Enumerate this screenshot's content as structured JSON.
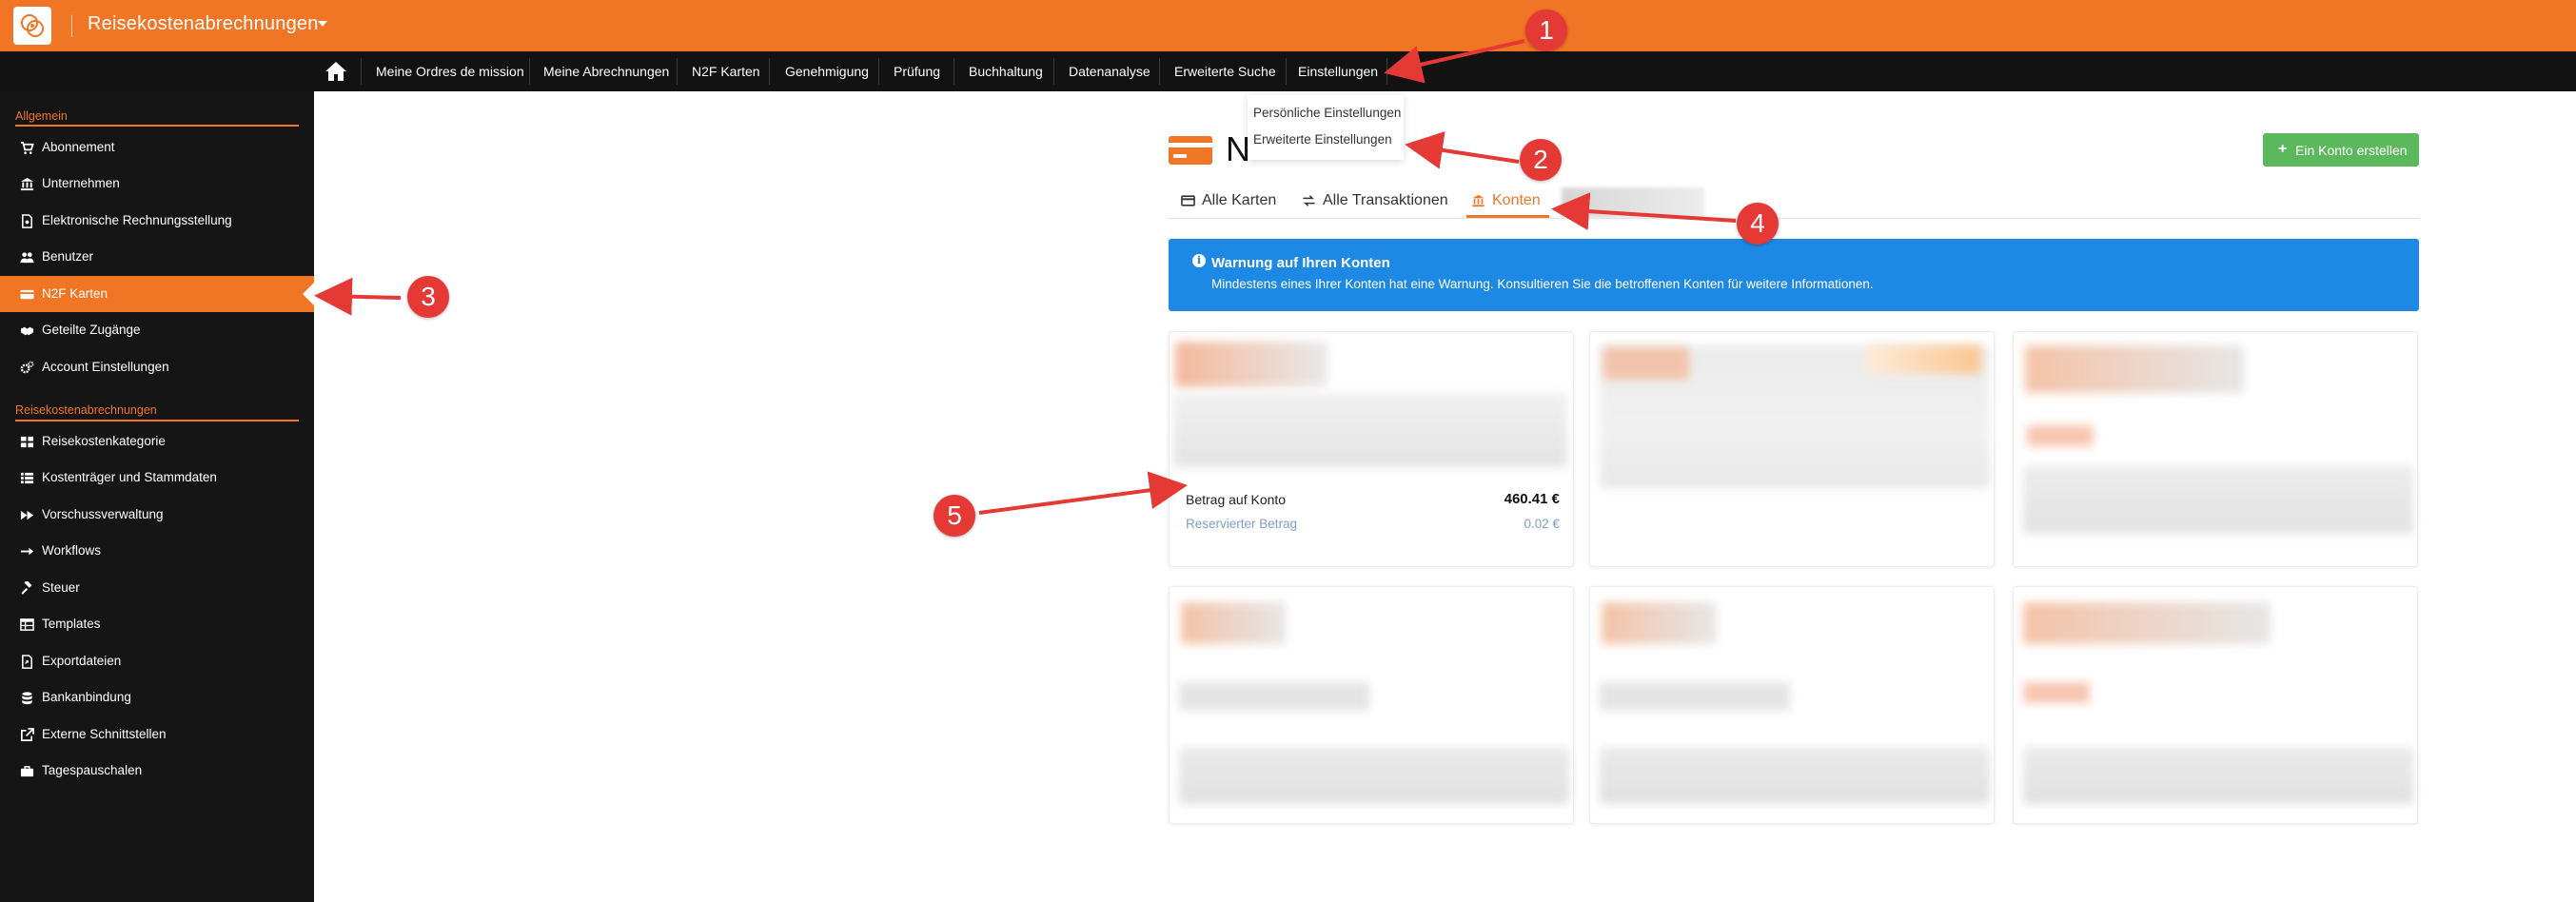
{
  "header": {
    "app_title": "Reisekostenabrechnungen",
    "brand_color": "#f07524"
  },
  "nav": {
    "items": [
      {
        "label": "Meine Ordres de mission"
      },
      {
        "label": "Meine Abrechnungen"
      },
      {
        "label": "N2F Karten"
      },
      {
        "label": "Genehmigung"
      },
      {
        "label": "Prüfung"
      },
      {
        "label": "Buchhaltung"
      },
      {
        "label": "Datenanalyse"
      },
      {
        "label": "Erweiterte Suche"
      },
      {
        "label": "Einstellungen"
      }
    ]
  },
  "dropdown": {
    "items": [
      {
        "label": "Persönliche Einstellungen"
      },
      {
        "label": "Erweiterte Einstellungen"
      }
    ]
  },
  "sidebar": {
    "section_general": "Allgemein",
    "section_expenses": "Reisekostenabrechnungen",
    "general_items": [
      {
        "label": "Abonnement",
        "icon": "cart-icon"
      },
      {
        "label": "Unternehmen",
        "icon": "bank-icon"
      },
      {
        "label": "Elektronische Rechnungsstellung",
        "icon": "document-icon"
      },
      {
        "label": "Benutzer",
        "icon": "users-icon"
      },
      {
        "label": "N2F Karten",
        "icon": "credit-card-icon",
        "active": true
      },
      {
        "label": "Geteilte Zugänge",
        "icon": "handshake-icon"
      },
      {
        "label": "Account Einstellungen",
        "icon": "gears-icon"
      }
    ],
    "expense_items": [
      {
        "label": "Reisekostenkategorie",
        "icon": "grid-icon"
      },
      {
        "label": "Kostenträger und Stammdaten",
        "icon": "list-icon"
      },
      {
        "label": "Vorschussverwaltung",
        "icon": "fast-forward-icon"
      },
      {
        "label": "Workflows",
        "icon": "arrow-right-icon"
      },
      {
        "label": "Steuer",
        "icon": "gavel-icon"
      },
      {
        "label": "Templates",
        "icon": "table-icon"
      },
      {
        "label": "Exportdateien",
        "icon": "export-icon"
      },
      {
        "label": "Bankanbindung",
        "icon": "database-icon"
      },
      {
        "label": "Externe Schnittstellen",
        "icon": "external-link-icon"
      },
      {
        "label": "Tagespauschalen",
        "icon": "briefcase-icon"
      }
    ]
  },
  "main": {
    "title_initial": "N",
    "create_button": "Ein Konto erstellen",
    "tabs": [
      {
        "label": "Alle Karten",
        "icon": "credit-card-icon"
      },
      {
        "label": "Alle Transaktionen",
        "icon": "exchange-icon"
      },
      {
        "label": "Konten",
        "icon": "bank-icon",
        "active": true
      }
    ],
    "alert": {
      "title": "Warnung auf Ihren Konten",
      "text": "Mindestens eines Ihrer Konten hat eine Warnung. Konsultieren Sie die betroffenen Konten für weitere Informationen.",
      "color": "#1e88e5"
    },
    "account": {
      "balance_label": "Betrag auf Konto",
      "balance_value": "460.41 €",
      "reserved_label": "Reservierter Betrag",
      "reserved_value": "0.02 €"
    }
  },
  "callouts": [
    "1",
    "2",
    "3",
    "4",
    "5"
  ],
  "annotation_color": "#e53935"
}
